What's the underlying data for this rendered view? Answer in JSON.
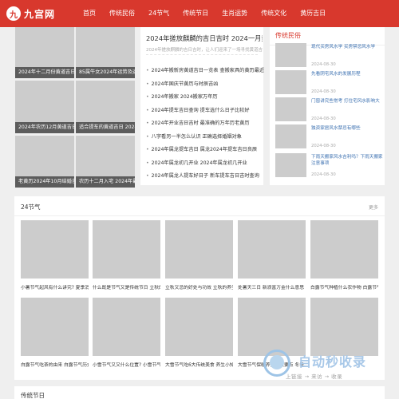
{
  "header": {
    "logo_glyph": "九",
    "logo_text": "九宫网",
    "bg_color": "#d8382d",
    "nav": [
      "首页",
      "传统民俗",
      "24节气",
      "传统节日",
      "生肖运势",
      "传统文化",
      "黄历吉日"
    ]
  },
  "grid": [
    "2024年十二月份黄道吉日有",
    "85属牛女2024年运势及运...",
    "2024年农历12月黄道吉日",
    "适合提车的黄道吉日 2024...",
    "老黄历2024年10月结婚吉...",
    "农历十二月入宅 2024年最..."
  ],
  "middle": {
    "headline": "2024年搓放麒麟的吉日吉时 2024一月黄道吉",
    "desc": "2024年搓放麒麟的吉日吉时，让人们迎来了一场寻找黄道吉",
    "list": [
      "2024年搬新房黄道吉日一览表 查搬家具的黄历最近",
      "2024年国庆节黄历与时辰吉凶",
      "2024年搬家 2024搬家万年历",
      "2024年提车吉日查询 提车选什么日子比较好",
      "2024年开业吉日吉时 最准确的万年历老黄历",
      "八字看另一半怎么认识 正确选择婚姻对象",
      "2024年属龙提车吉日 属龙2024年提车吉日良辰",
      "2024年属龙初几开业 2024年属龙初几开业",
      "2024年属龙人提车好日子 新车提车吉日吉时查询"
    ]
  },
  "right": {
    "title": "传统民俗",
    "items": [
      {
        "title": "现代买房风水学 买房禁忌风水学",
        "date": "2024-08-30"
      },
      {
        "title": "先看阴宅风水的发展历程",
        "date": "2024-08-30"
      },
      {
        "title": "门窗讲究些常考 打住宅风水影响大",
        "date": "2024-08-30"
      },
      {
        "title": "独资家居风水禁忌有哪些",
        "date": "2024-08-30"
      },
      {
        "title": "下雨天搬家风水吉利吗？下雨天搬家注意事项",
        "date": "2024-08-30"
      }
    ]
  },
  "jieqi": {
    "title": "24节气",
    "more": "更多",
    "cards": [
      "小暑节气起风有什么讲究? 夏季消",
      "什么既是节气又是传统节日 立秋的",
      "立秋又忌的好处与功效 立秋的养生",
      "处暑天三日 新浪富万金什么意思",
      "白露节气种植什么农作物 白露节气",
      "白露节气吃茶的由来 白露节气历史",
      "小雪节气又又什么位置? 小雪节气",
      "大雪节气吃6大传统美食 养生小知",
      "大雪节气保暖养生三大要点 冬季...",
      ""
    ]
  },
  "bottom": {
    "title": "传统节日"
  },
  "watermark": {
    "text": "自动秒收录",
    "sub": "上链接 → 来访 → 收录"
  }
}
